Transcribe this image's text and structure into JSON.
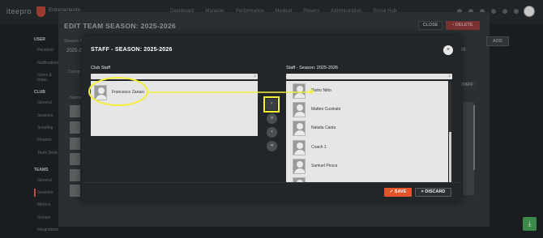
{
  "app": {
    "logo": "iteepro",
    "club_name": "Entrenamiento"
  },
  "nav": [
    "Dashboard",
    "Manager",
    "Performance",
    "Medical",
    "Players",
    "Administration",
    "Social Hub"
  ],
  "sidebar": {
    "sections": [
      {
        "heading": "USER",
        "items": [
          "Personal",
          "Notifications",
          "Users & Roles"
        ]
      },
      {
        "heading": "CLUB",
        "items": [
          "General",
          "Seasons",
          "Scouting",
          "Finance",
          "Team Desk"
        ]
      },
      {
        "heading": "TEAMS",
        "items": [
          "General",
          "Seasons",
          "Metrics",
          "Groups",
          "Integrations"
        ]
      }
    ]
  },
  "background_panel": {
    "title": "EDIT TEAM SEASON: 2025-2026",
    "close_label": "CLOSE",
    "delete_label": "DELETE",
    "season_label": "Season N",
    "season_value": "2025-2",
    "comp_label": "Comp",
    "name_col": "Name",
    "add_label": "ADD",
    "staff_label": "STAFF",
    "season_right": "26"
  },
  "modal": {
    "title": "STAFF - SEASON: 2025-2026",
    "close_glyph": "×",
    "left_title": "Club Staff",
    "right_title": "Staff - Season: 2025-2026",
    "club_staff": [
      {
        "name": "Francesco Zanasi"
      }
    ],
    "season_staff": [
      {
        "name": "Pietro Nitto"
      },
      {
        "name": "Matteo Cusinato"
      },
      {
        "name": "Natalia Cantu"
      },
      {
        "name": "Coach 1"
      },
      {
        "name": "Samuel Pesca"
      },
      {
        "name": ""
      }
    ],
    "transfer_buttons": [
      "›",
      "»",
      "‹",
      "«"
    ],
    "save_label": "SAVE",
    "save_glyph": "✓",
    "discard_label": "DISCARD",
    "discard_glyph": "×"
  },
  "colors": {
    "accent": "#e8542a",
    "highlight": "#f5ef3a",
    "modal_bg": "#222628"
  },
  "icons": {
    "search": "search-icon",
    "person": "person-placeholder-icon",
    "download": "download-icon"
  }
}
